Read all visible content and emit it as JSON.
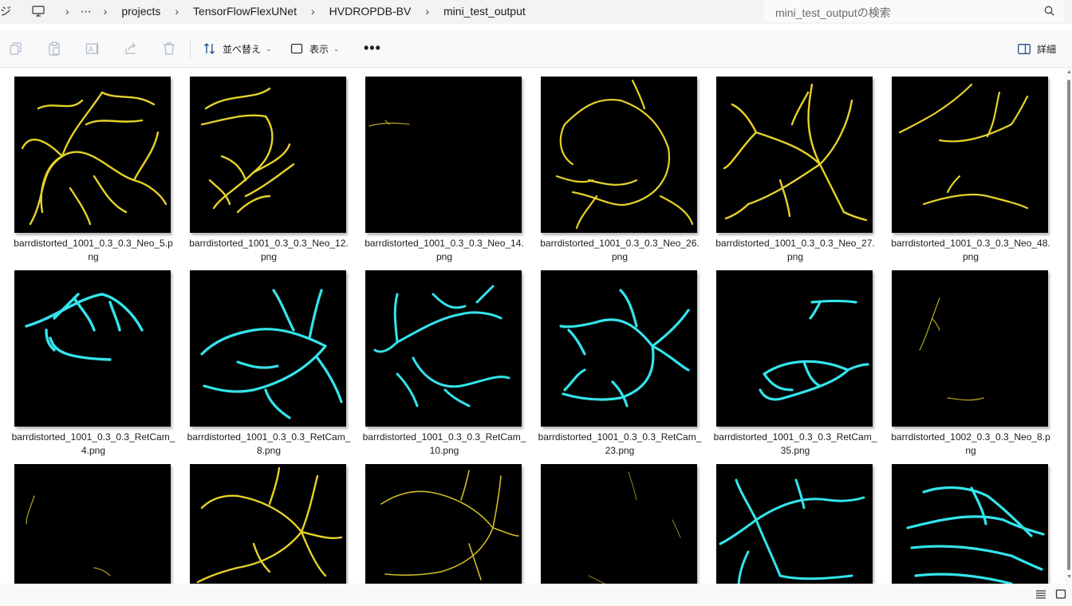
{
  "address": {
    "crumbs": [
      "projects",
      "TensorFlowFlexUNet",
      "HVDROPDB-BV",
      "mini_test_output"
    ],
    "overflow": "⋯",
    "edge_glyph": "ジ"
  },
  "search": {
    "placeholder": "mini_test_outputの検索"
  },
  "toolbar": {
    "icons": [
      "copy-icon",
      "paste-icon",
      "rename-icon",
      "share-icon",
      "delete-icon"
    ],
    "sort_label": "並べ替え",
    "view_label": "表示",
    "more_label": "•••",
    "details_label": "詳細"
  },
  "files": [
    {
      "name": "barrdistorted_1001_0.3_0.3_Neo_5.png",
      "color": "yellow"
    },
    {
      "name": "barrdistorted_1001_0.3_0.3_Neo_12.png",
      "color": "yellow"
    },
    {
      "name": "barrdistorted_1001_0.3_0.3_Neo_14.png",
      "color": "yellow"
    },
    {
      "name": "barrdistorted_1001_0.3_0.3_Neo_26.png",
      "color": "yellow"
    },
    {
      "name": "barrdistorted_1001_0.3_0.3_Neo_27.png",
      "color": "yellow"
    },
    {
      "name": "barrdistorted_1001_0.3_0.3_Neo_48.png",
      "color": "yellow"
    },
    {
      "name": "barrdistorted_1001_0.3_0.3_RetCam_4.png",
      "color": "cyan"
    },
    {
      "name": "barrdistorted_1001_0.3_0.3_RetCam_8.png",
      "color": "cyan"
    },
    {
      "name": "barrdistorted_1001_0.3_0.3_RetCam_10.png",
      "color": "cyan"
    },
    {
      "name": "barrdistorted_1001_0.3_0.3_RetCam_23.png",
      "color": "cyan"
    },
    {
      "name": "barrdistorted_1001_0.3_0.3_RetCam_35.png",
      "color": "cyan"
    },
    {
      "name": "barrdistorted_1002_0.3_0.3_Neo_8.png",
      "color": "yellow"
    },
    {
      "name": "",
      "color": "yellow"
    },
    {
      "name": "",
      "color": "yellow"
    },
    {
      "name": "",
      "color": "yellow"
    },
    {
      "name": "",
      "color": "yellow"
    },
    {
      "name": "",
      "color": "cyan"
    },
    {
      "name": "",
      "color": "cyan"
    }
  ],
  "colors": {
    "yellow_vessel": "#e6d22a",
    "cyan_vessel": "#34e4ec",
    "thumb_bg": "#000000",
    "window_bg": "#f3f3f3"
  }
}
